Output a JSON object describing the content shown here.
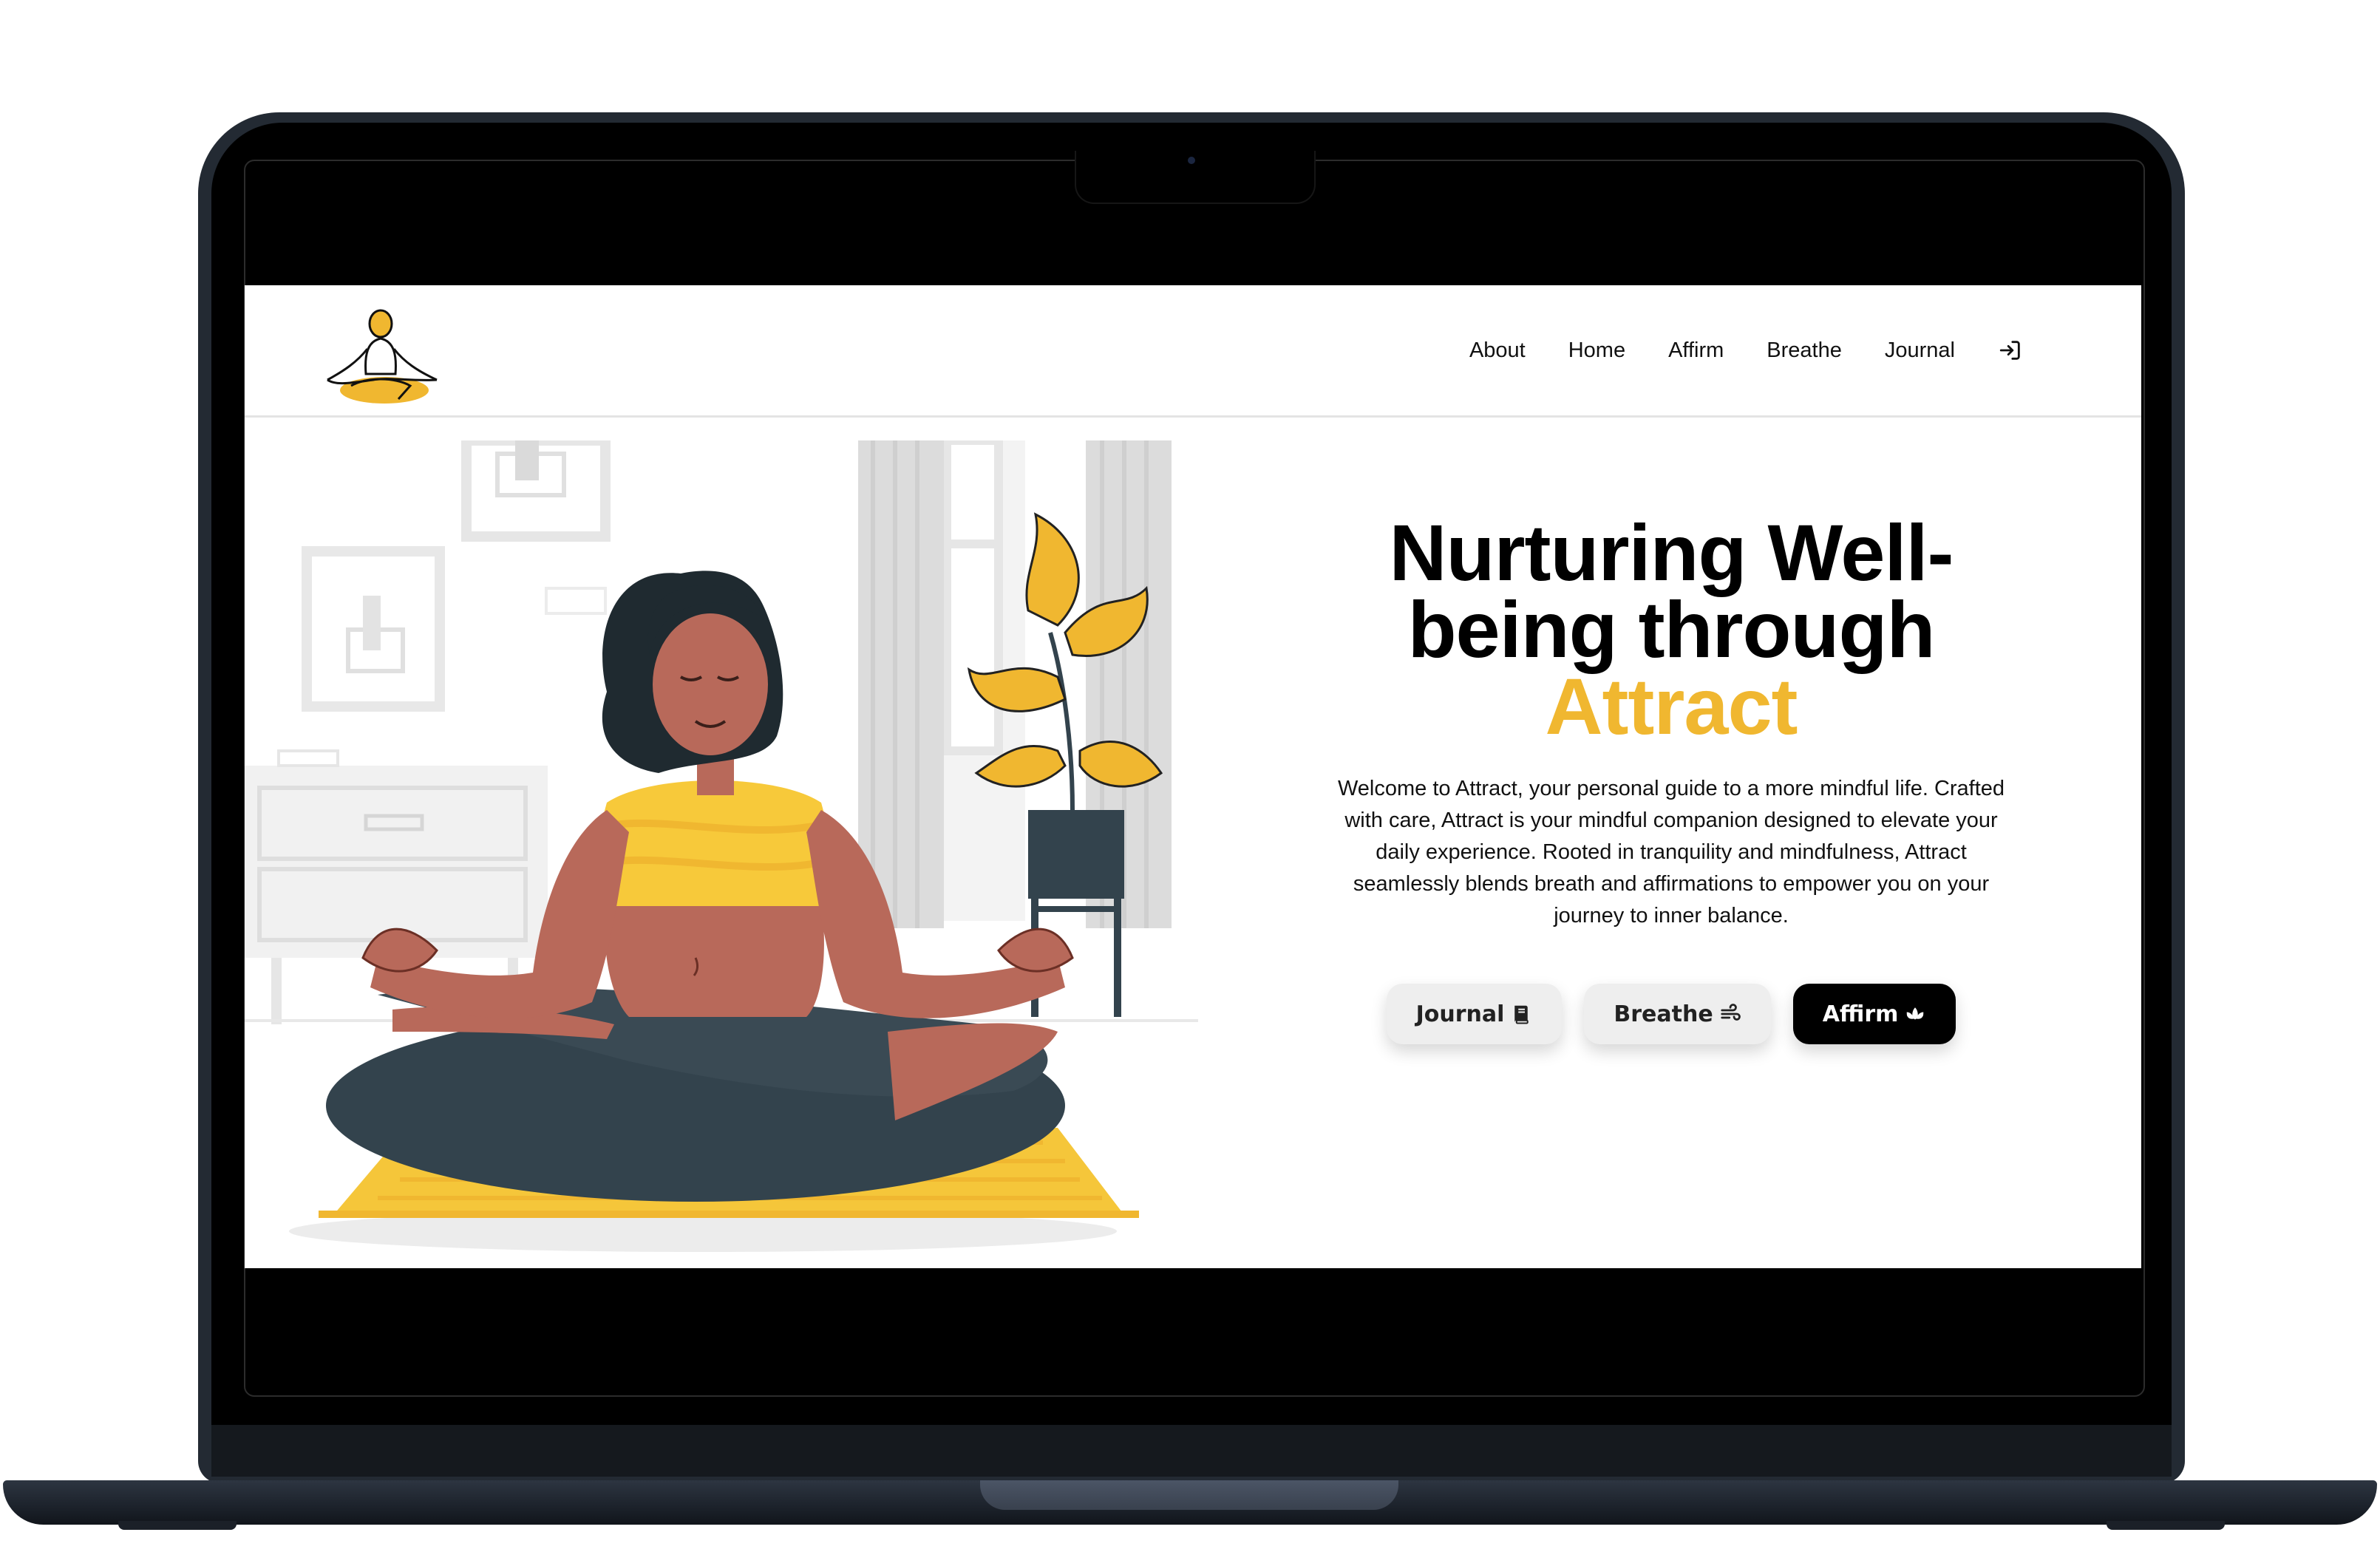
{
  "nav": {
    "items": [
      "About",
      "Home",
      "Affirm",
      "Breathe",
      "Journal"
    ],
    "login_icon": "login-icon"
  },
  "hero": {
    "headline_line1": "Nurturing Well-",
    "headline_line2": "being through",
    "headline_brand": "Attract",
    "description": "Welcome to Attract, your personal guide to a more mindful life. Crafted with care, Attract is your mindful companion designed to elevate your daily experience. Rooted in tranquility and mindfulness, Attract seamlessly blends breath and affirmations to empower you on your journey to inner balance.",
    "buttons": {
      "journal": "Journal",
      "breathe": "Breathe",
      "affirm": "Affirm"
    },
    "button_icons": [
      "book-icon",
      "wind-icon",
      "lotus-icon"
    ]
  },
  "colors": {
    "accent": "#f0b730",
    "text": "#000000",
    "button_light": "#eeeeee",
    "button_dark": "#000000",
    "skin": "#b8695a",
    "pants": "#33434d",
    "shirt": "#f7c93a",
    "frame": "#232a33"
  }
}
